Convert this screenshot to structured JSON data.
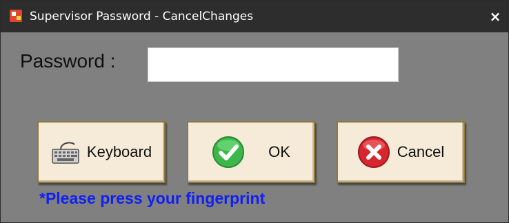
{
  "window": {
    "title": "Supervisor Password - CancelChanges",
    "close_label": "×"
  },
  "form": {
    "password_label": "Password :",
    "password_value": ""
  },
  "buttons": {
    "keyboard_label": "Keyboard",
    "ok_label": "OK",
    "cancel_label": "Cancel"
  },
  "hint": "*Please press your fingerprint",
  "colors": {
    "titlebar": "#2d2d2d",
    "window_bg": "#808080",
    "button_bg": "#f6ead8",
    "hint": "#1020f0",
    "ok_green": "#3cb84a",
    "cancel_red": "#d8262e"
  },
  "icons": {
    "app": "app-icon",
    "keyboard": "keyboard-icon",
    "ok": "checkmark-icon",
    "cancel": "cross-icon"
  }
}
